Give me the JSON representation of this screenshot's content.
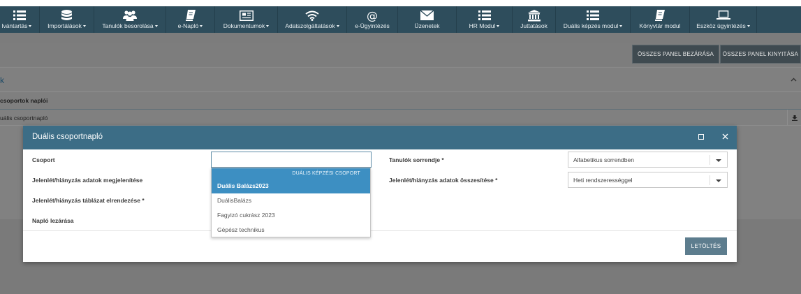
{
  "navbar": {
    "items": [
      {
        "label": "lvántartás",
        "icon": "list-icon",
        "caret": true
      },
      {
        "label": "Importálások",
        "icon": "database-icon",
        "caret": true
      },
      {
        "label": "Tanulók besorolása",
        "icon": "users-icon",
        "caret": true
      },
      {
        "label": "e-Napló",
        "icon": "book-icon",
        "caret": true
      },
      {
        "label": "Dokumentumok",
        "icon": "newspaper-icon",
        "caret": true
      },
      {
        "label": "Adatszolgáltatások",
        "icon": "wifi-icon",
        "caret": true
      },
      {
        "label": "e-Ügyintézés",
        "icon": "at-icon",
        "caret": false
      },
      {
        "label": "Üzenetek",
        "icon": "envelope-icon",
        "caret": false
      },
      {
        "label": "HR Modul",
        "icon": "list-icon",
        "caret": true
      },
      {
        "label": "Juttatások",
        "icon": "bank-icon",
        "caret": false
      },
      {
        "label": "Duális képzés modul",
        "icon": "list-icon",
        "caret": true
      },
      {
        "label": "Könyvtár modul",
        "icon": "book-icon",
        "caret": false
      },
      {
        "label": "Eszköz ügyintézés",
        "icon": "laptop-icon",
        "caret": true
      }
    ]
  },
  "page": {
    "close_all_label": "ÖSSZES PANEL BEZÁRÁSA",
    "open_all_label": "ÖSSZES PANEL KINYITÁSA",
    "panel_title_fragment": "k",
    "sub_label": "csoportok naplói",
    "sub_row_text": "uális csoportnapló"
  },
  "modal": {
    "title": "Duális csoportnapló",
    "fields": {
      "group_label": "Csoport",
      "group_value": "",
      "attendance_display_label": "Jelenlét/hiányzás adatok megjelenítése",
      "attendance_table_label": "Jelenlét/hiányzás táblázat elrendezése *",
      "close_journal_label": "Napló lezárása",
      "student_order_label": "Tanulók sorrendje *",
      "student_order_value": "Alfabetikus sorrendben",
      "attendance_summary_label": "Jelenlét/hiányzás adatok összesítése *",
      "attendance_summary_value": "Heti rendszerességgel"
    },
    "download_label": "LETÖLTÉS"
  },
  "dropdown": {
    "group_title": "DUÁLIS KÉPZÉSI CSOPORT",
    "options": [
      {
        "label": "Duális Balázs2023",
        "active": true
      },
      {
        "label": "DuálisBalázs",
        "active": false
      },
      {
        "label": "Fagyizó cukrász 2023",
        "active": false
      },
      {
        "label": "Gépész technikus",
        "active": false
      }
    ]
  },
  "colors": {
    "navbar": "#2e4d5c",
    "modal_header": "#3c6d86",
    "dropdown_active": "#3d8fc2",
    "download_button": "#5d7d8e"
  }
}
